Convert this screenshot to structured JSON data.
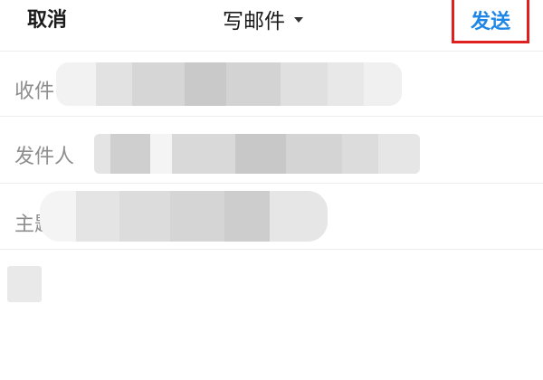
{
  "header": {
    "cancel_label": "取消",
    "title": "写邮件",
    "send_label": "发送",
    "highlight_color": "#e0201f",
    "send_color": "#1e86e6"
  },
  "fields": {
    "recipient_label": "收件",
    "sender_label": "发件人",
    "subject_label": "主题"
  },
  "body": {
    "content": ""
  }
}
